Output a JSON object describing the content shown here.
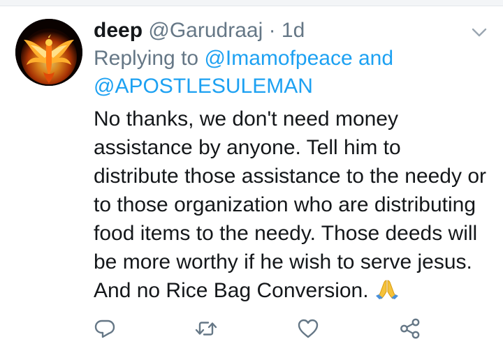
{
  "tweet": {
    "display_name": "deep",
    "handle": "@Garudraaj",
    "separator": "·",
    "timestamp": "1d",
    "replying_prefix": "Replying to",
    "reply_mention_1": "@Imamofpeace",
    "reply_conjunction": "and",
    "reply_mention_2": "@APOSTLESULEMAN",
    "text": "No thanks, we don't need money\nassistance by anyone. Tell him to\ndistribute those assistance to the needy or\nto those organization who are distributing\nfood items to the needy. Those deeds will\nbe more worthy if he wish to serve jesus.\nAnd no Rice Bag Conversion.",
    "emoji": "folded-hands"
  },
  "icons": {
    "avatar": "phoenix-fire-avatar",
    "menu": "chevron-down-icon",
    "reply": "reply-icon",
    "retweet": "retweet-icon",
    "like": "heart-icon",
    "share": "share-icon"
  },
  "colors": {
    "primary_text": "#14171a",
    "secondary_text": "#657786",
    "link": "#1da1f2",
    "icon": "#657786",
    "divider": "#e6ecf0"
  }
}
